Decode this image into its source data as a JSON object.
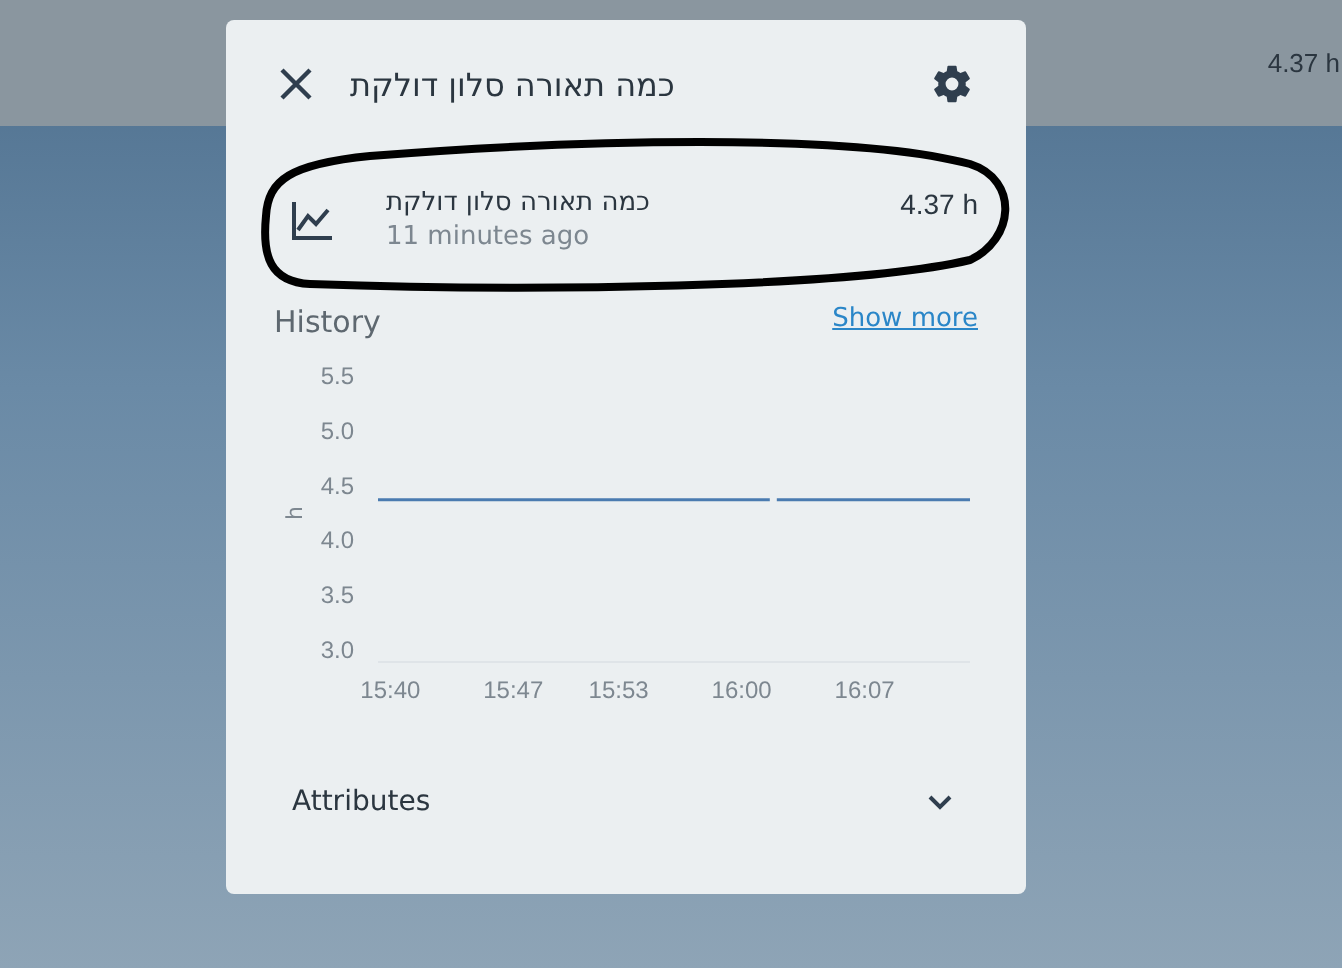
{
  "background": {
    "top_bar_value": "4.37 h"
  },
  "dialog": {
    "title": "כמה תאורה סלון דולקת",
    "entity": {
      "name": "כמה תאורה סלון דולקת",
      "last_changed": "11 minutes ago",
      "state": "4.37 h"
    },
    "history": {
      "heading": "History",
      "show_more": "Show more",
      "chart_data": {
        "type": "line",
        "ylabel": "h",
        "x": [
          15.655,
          16.0267,
          16.0333,
          16.2167
        ],
        "xlim": [
          15.655,
          16.2167
        ],
        "ylim": [
          3.0,
          5.5
        ],
        "series": [
          {
            "color": "#4a7bb0",
            "values": [
              4.37,
              4.37,
              null,
              null
            ]
          },
          {
            "color": "#4a7bb0",
            "values": [
              null,
              null,
              4.37,
              4.37
            ]
          }
        ],
        "xticks": [
          {
            "value": 15.6667,
            "label": "15:40"
          },
          {
            "value": 15.7833,
            "label": "15:47"
          },
          {
            "value": 15.8833,
            "label": "15:53"
          },
          {
            "value": 16.0,
            "label": "16:00"
          },
          {
            "value": 16.1167,
            "label": "16:07"
          }
        ],
        "yticks": [
          {
            "value": 3.0,
            "label": "3.0"
          },
          3.5,
          {
            "value": 4.0,
            "label": "4.0"
          },
          4.5,
          {
            "value": 5.0,
            "label": "5.0"
          },
          5.5
        ]
      }
    },
    "attributes": {
      "label": "Attributes",
      "expanded": false
    }
  },
  "annotation": {
    "kind": "ellipse"
  }
}
